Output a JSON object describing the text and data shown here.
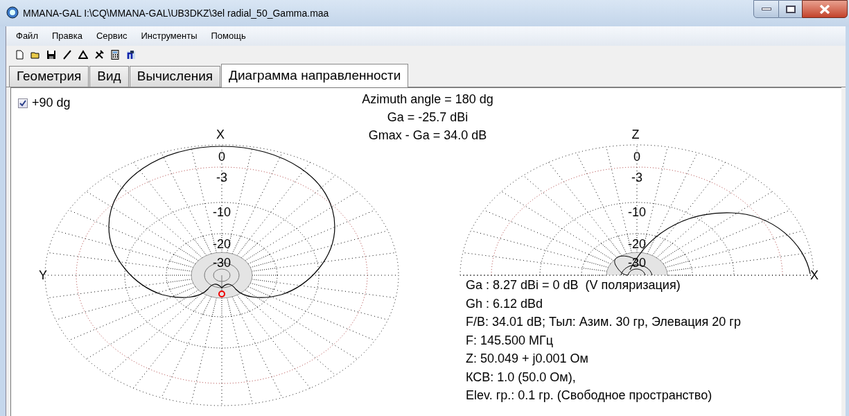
{
  "window": {
    "title": "MMANA-GAL I:\\CQ\\MMANA-GAL\\UB3DKZ\\3el radial_50_Gamma.maa"
  },
  "menu": [
    "Файл",
    "Правка",
    "Сервис",
    "Инструменты",
    "Помощь"
  ],
  "tabs": [
    {
      "label": "Геометрия",
      "selected": false
    },
    {
      "label": "Вид",
      "selected": false
    },
    {
      "label": "Вычисления",
      "selected": false
    },
    {
      "label": "Диаграмма направленности",
      "selected": true
    }
  ],
  "checkbox": {
    "label": "+90 dg",
    "checked": true
  },
  "header_lines": [
    "Azimuth angle = 180 dg",
    "Ga = -25.7 dBi",
    "Gmax - Ga = 34.0 dB"
  ],
  "plots": [
    {
      "kind": "horizontal",
      "axis_top": "X",
      "axis_side": "Y",
      "ring_labels": [
        "0",
        "-3",
        "-10",
        "-20",
        "-30"
      ]
    },
    {
      "kind": "vertical",
      "axis_top": "Z",
      "axis_side": "X",
      "ring_labels": [
        "0",
        "-3",
        "-10",
        "-20",
        "-30"
      ]
    }
  ],
  "info_lines": [
    "Ga : 8.27 dBi = 0 dB  (V поляризация)",
    "Gh : 6.12 dBd",
    "F/B: 34.01 dB; Тыл: Азим. 30 гр, Элевация 20 гр",
    "F: 145.500 МГц",
    "Z: 50.049 + j0.001 Ом",
    "КСВ: 1.0 (50.0 Ом),",
    "Elev. гр.: 0.1 гр. (Свободное пространство)"
  ]
}
